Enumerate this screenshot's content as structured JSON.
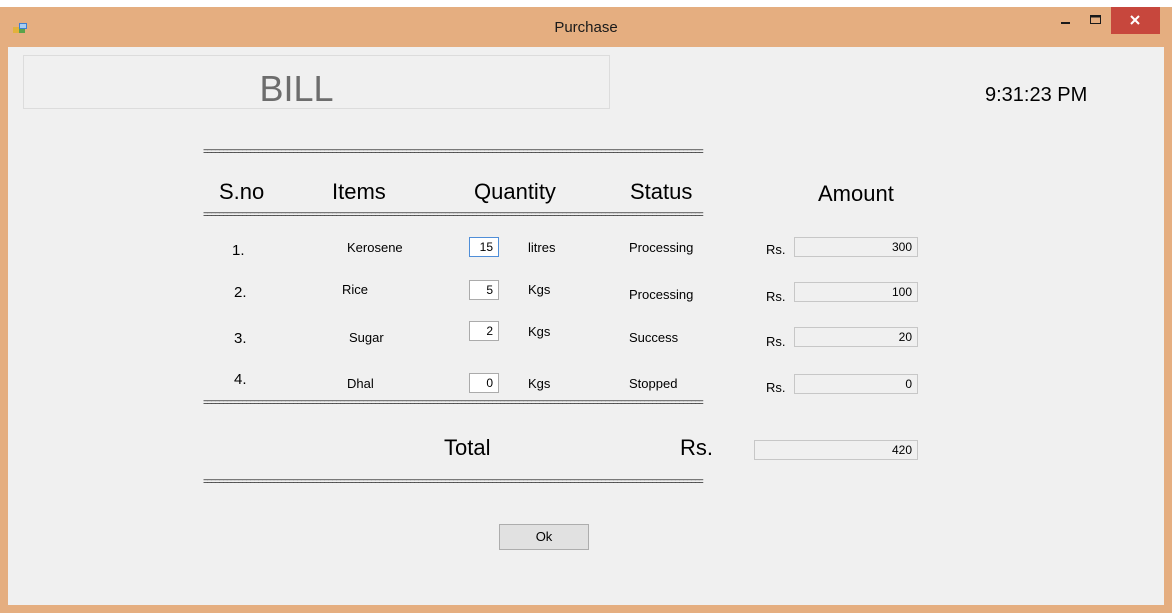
{
  "window": {
    "title": "Purchase",
    "close_color": "#c7473d",
    "frame_color": "#e5ae80"
  },
  "bill": {
    "title": "BILL"
  },
  "clock": {
    "time": "9:31:23 PM"
  },
  "separator": "================================================================================================================================",
  "headers": {
    "sno": "S.no",
    "items": "Items",
    "quantity": "Quantity",
    "status": "Status",
    "amount": "Amount"
  },
  "rows": [
    {
      "sno": "1.",
      "item": "Kerosene",
      "qty": "15",
      "unit": "litres",
      "status": "Processing",
      "rs": "Rs.",
      "amount": "300"
    },
    {
      "sno": "2.",
      "item": "Rice",
      "qty": "5",
      "unit": "Kgs",
      "status": "Processing",
      "rs": "Rs.",
      "amount": "100"
    },
    {
      "sno": "3.",
      "item": "Sugar",
      "qty": "2",
      "unit": "Kgs",
      "status": "Success",
      "rs": "Rs.",
      "amount": "20"
    },
    {
      "sno": "4.",
      "item": "Dhal",
      "qty": "0",
      "unit": "Kgs",
      "status": "Stopped",
      "rs": "Rs.",
      "amount": "0"
    }
  ],
  "total": {
    "label": "Total",
    "rs": "Rs.",
    "value": "420"
  },
  "ok_button": {
    "label": "Ok"
  },
  "icons": {
    "app": "form-app-icon",
    "minimize": "minimize-icon",
    "maximize": "maximize-icon",
    "close": "close-icon"
  }
}
